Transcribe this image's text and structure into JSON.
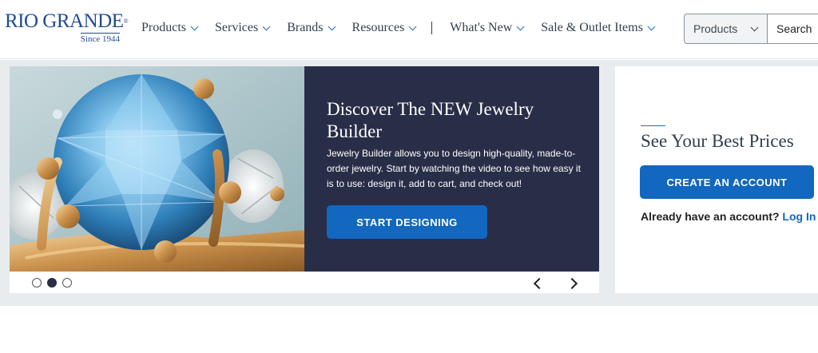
{
  "header": {
    "logo": {
      "name": "RIO GRANDE",
      "reg": "®",
      "since": "Since 1944"
    },
    "nav": [
      {
        "label": "Products"
      },
      {
        "label": "Services"
      },
      {
        "label": "Brands"
      },
      {
        "label": "Resources"
      }
    ],
    "nav_separator": "|",
    "nav_secondary": [
      {
        "label": "What's New"
      },
      {
        "label": "Sale & Outlet Items"
      }
    ],
    "search": {
      "category": "Products",
      "placeholder": "Search"
    }
  },
  "carousel": {
    "slide": {
      "title": "Discover The NEW Jewelry Builder",
      "description": "Jewelry Builder allows you to design high-quality, made-to-order jewelry. Start by watching the video to see how easy it is to use: design it, add to cart, and check out!",
      "button": "START DESIGNING",
      "image": "blue-gemstone-gold-ring"
    },
    "dots": [
      {
        "active": false
      },
      {
        "active": true
      },
      {
        "active": false
      }
    ],
    "prev_icon": "chevron-left-icon",
    "next_icon": "chevron-right-icon"
  },
  "account": {
    "title": "See Your Best Prices",
    "create_button": "CREATE AN ACCOUNT",
    "login_prompt": "Already have an account?",
    "login_link": "Log In"
  },
  "colors": {
    "brand_blue": "#1f4c8f",
    "button_blue": "#1267be",
    "panel_navy": "#292e48",
    "page_bg": "#e9ecef"
  }
}
